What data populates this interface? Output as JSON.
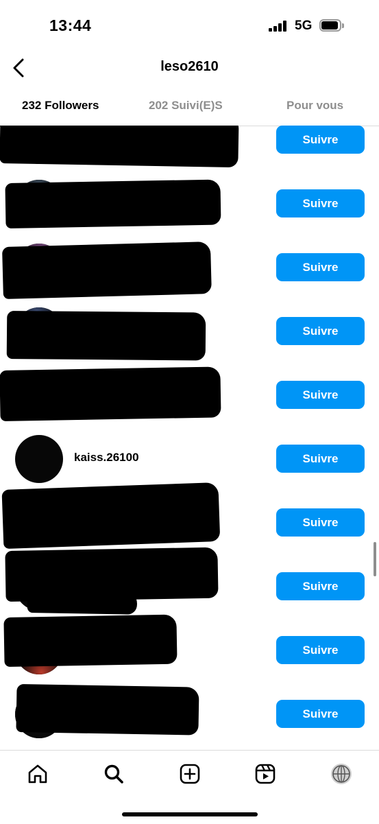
{
  "status_bar": {
    "time": "13:44",
    "network": "5G"
  },
  "header": {
    "title": "leso2610",
    "back_icon": "chevron-left-icon"
  },
  "tabs": [
    {
      "label": "232 Followers",
      "active": true
    },
    {
      "label": "202 Suivi(E)S",
      "active": false
    },
    {
      "label": "Pour vous",
      "active": false
    }
  ],
  "follow_label": "Suivre",
  "followers": [
    {
      "username": "",
      "redacted": true,
      "button": "Suivre"
    },
    {
      "username": "",
      "redacted": true,
      "button": "Suivre"
    },
    {
      "username": "",
      "redacted": true,
      "button": "Suivre"
    },
    {
      "username": "",
      "redacted": true,
      "button": "Suivre"
    },
    {
      "username": "",
      "redacted": true,
      "button": "Suivre"
    },
    {
      "username": "kaiss.26100",
      "redacted": false,
      "button": "Suivre"
    },
    {
      "username": "",
      "redacted": true,
      "button": "Suivre"
    },
    {
      "username": "",
      "redacted": true,
      "button": "Suivre"
    },
    {
      "username": "",
      "redacted": true,
      "button": "Suivre"
    },
    {
      "username": "",
      "redacted": true,
      "button": "Suivre"
    }
  ],
  "bottom_nav": [
    {
      "name": "home-icon"
    },
    {
      "name": "search-icon",
      "active": true
    },
    {
      "name": "create-post-icon"
    },
    {
      "name": "reels-icon"
    },
    {
      "name": "profile-icon"
    }
  ],
  "colors": {
    "accent": "#0095f6",
    "muted": "#8e8e8e",
    "divider": "#dbdbdb"
  }
}
